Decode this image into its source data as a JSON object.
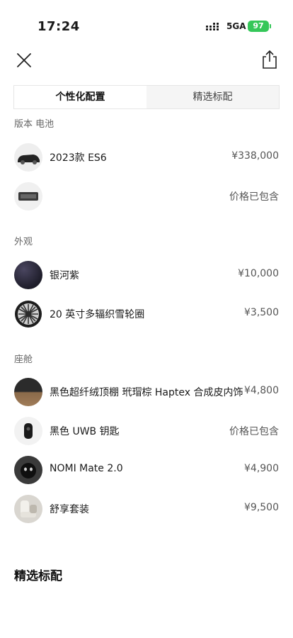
{
  "status_bar": {
    "time": "17:24",
    "network": "5GA",
    "battery": "97"
  },
  "tabs": {
    "active": "个性化配置",
    "inactive": "精选标配"
  },
  "sections": {
    "version_battery": {
      "title": "版本 电池",
      "items": [
        {
          "name": "2023款 ES6",
          "price": "¥338,000",
          "icon": "car-thumbnail"
        },
        {
          "name": "",
          "price": "价格已包含",
          "icon": "battery-pack-thumbnail"
        }
      ]
    },
    "exterior": {
      "title": "外观",
      "items": [
        {
          "name": "银河紫",
          "price": "¥10,000",
          "icon": "paint-color-swatch"
        },
        {
          "name": "20 英寸多辐织雪轮圈",
          "price": "¥3,500",
          "icon": "wheel-rim-thumbnail"
        }
      ]
    },
    "cabin": {
      "title": "座舱",
      "items": [
        {
          "name": "黑色超纤绒顶棚 玳瑁棕 Haptex 合成皮内饰",
          "price": "¥4,800",
          "icon": "interior-swatch"
        },
        {
          "name": "黑色 UWB 钥匙",
          "price": "价格已包含",
          "icon": "key-fob-thumbnail"
        },
        {
          "name": "NOMI Mate 2.0",
          "price": "¥4,900",
          "icon": "nomi-thumbnail"
        },
        {
          "name": "舒享套装",
          "price": "¥9,500",
          "icon": "seat-thumbnail"
        }
      ]
    }
  },
  "bottom_heading": "精选标配",
  "colors": {
    "battery_green": "#35c759",
    "galaxy_purple": "#2b2a3a"
  }
}
